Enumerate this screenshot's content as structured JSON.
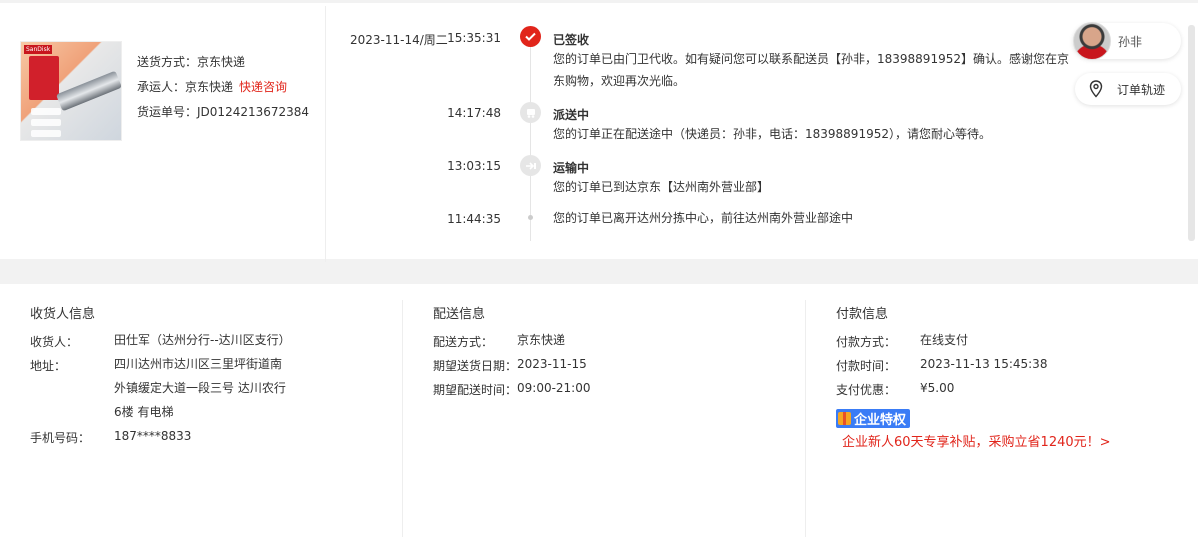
{
  "shipping": {
    "method_label": "送货方式：",
    "method_value": "京东快递",
    "carrier_label": "承运人：",
    "carrier_value": "京东快递",
    "consult_link": "快递咨询",
    "waybill_label": "货运单号：",
    "waybill_value": "JD0124213672384"
  },
  "product_image": {
    "brand_text": "SanDisk"
  },
  "timeline": {
    "date": "2023-11-14/周二",
    "events": [
      {
        "time": "15:35:31",
        "title": "已签收",
        "desc": "您的订单已由门卫代收。如有疑问您可以联系配送员【孙非，18398891952】确认。感谢您在京东购物，欢迎再次光临。",
        "icon": "check-icon"
      },
      {
        "time": "14:17:48",
        "title": "派送中",
        "desc": "您的订单正在配送途中（快递员：孙非，电话：18398891952），请您耐心等待。",
        "icon": "delivery-icon"
      },
      {
        "time": "13:03:15",
        "title": "运输中",
        "desc": "您的订单已到达京东【达州南外营业部】",
        "icon": "transport-icon"
      },
      {
        "time": "11:44:35",
        "title": "",
        "desc": "您的订单已离开达州分拣中心，前往达州南外营业部途中",
        "icon": "dot-icon"
      }
    ]
  },
  "courier": {
    "name": "孙非"
  },
  "track_button": {
    "label": "订单轨迹",
    "icon": "location-pin-icon"
  },
  "receiver": {
    "heading": "收货人信息",
    "name_label": "收货人：",
    "name_value": "田仕军（达州分行--达川区支行）",
    "address_label": "地址：",
    "address_line1": "四川达州市达川区三里坪街道南",
    "address_line2": "外镇缓定大道一段三号 达川农行",
    "address_line3": "6楼 有电梯",
    "phone_label": "手机号码：",
    "phone_value": "187****8833"
  },
  "delivery": {
    "heading": "配送信息",
    "method_label": "配送方式：",
    "method_value": "京东快递",
    "date_label": "期望送货日期：",
    "date_value": "2023-11-15",
    "time_label": "期望配送时间：",
    "time_value": "09:00-21:00"
  },
  "payment": {
    "heading": "付款信息",
    "method_label": "付款方式：",
    "method_value": "在线支付",
    "time_label": "付款时间：",
    "time_value": "2023-11-13 15:45:38",
    "discount_label": "支付优惠：",
    "discount_value": "¥5.00",
    "enterprise_badge": "企业特权",
    "enterprise_promo": "企业新人60天专享补贴，采购立省1240元！>"
  },
  "colors": {
    "accent_red": "#e1251b",
    "badge_blue": "#3a7cf6"
  }
}
